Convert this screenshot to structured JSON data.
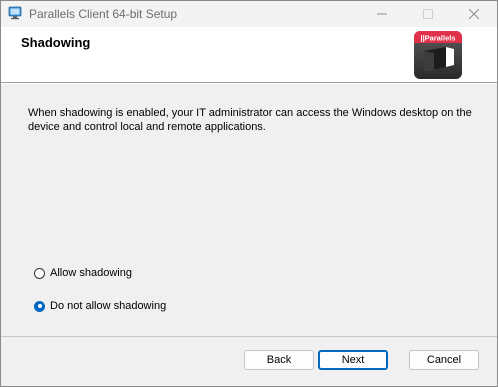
{
  "window": {
    "title": "Parallels Client 64-bit Setup",
    "accent_color": "#0067c0"
  },
  "header": {
    "title": "Shadowing",
    "logo_text": "||Parallels",
    "logo_color": "#e0304a"
  },
  "main": {
    "description": "When shadowing is enabled, your IT administrator can access the Windows desktop on the device and control local and remote applications."
  },
  "options": [
    {
      "label": "Allow shadowing",
      "selected": false
    },
    {
      "label": "Do not allow shadowing",
      "selected": true
    }
  ],
  "buttons": {
    "back": "Back",
    "next": "Next",
    "cancel": "Cancel"
  }
}
